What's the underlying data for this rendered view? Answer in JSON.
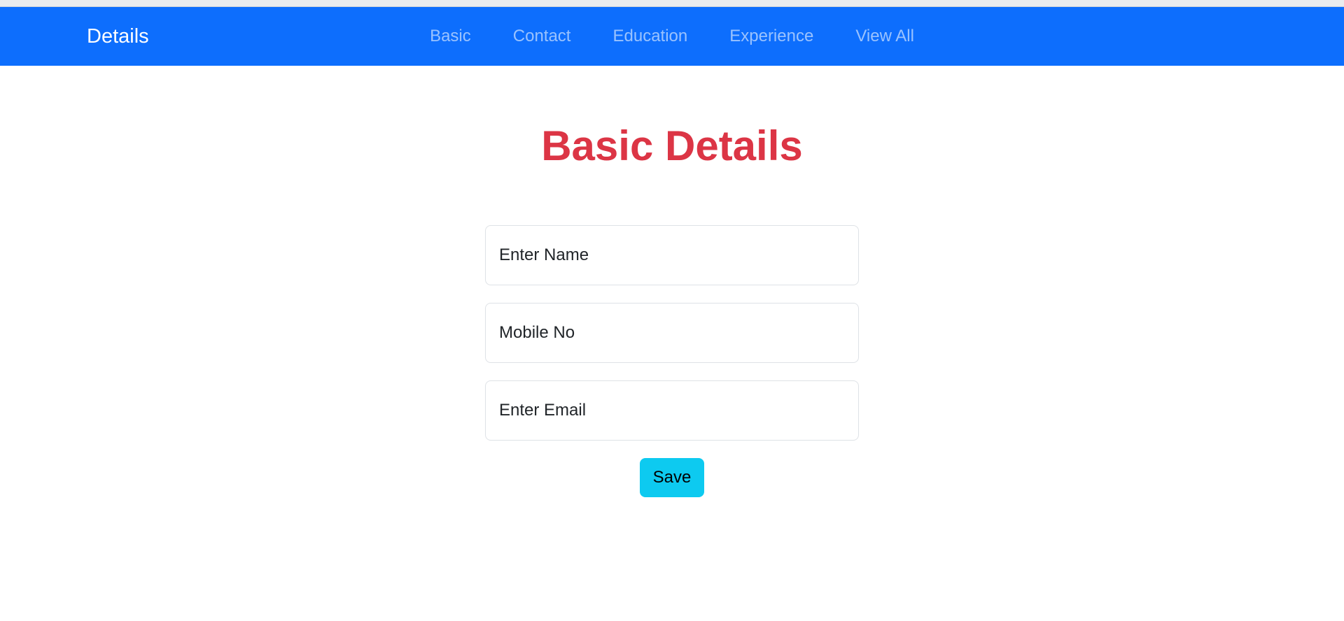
{
  "navbar": {
    "brand": "Details",
    "links": [
      {
        "label": "Basic"
      },
      {
        "label": "Contact"
      },
      {
        "label": "Education"
      },
      {
        "label": "Experience"
      },
      {
        "label": "View All"
      }
    ]
  },
  "main": {
    "title": "Basic Details",
    "fields": [
      {
        "placeholder": "Enter Name",
        "value": ""
      },
      {
        "placeholder": "Mobile No",
        "value": ""
      },
      {
        "placeholder": "Enter Email",
        "value": ""
      }
    ],
    "save_label": "Save"
  },
  "colors": {
    "navbar_bg": "#0d6efd",
    "title": "#dc3545",
    "save_button": "#0dcaf0"
  }
}
